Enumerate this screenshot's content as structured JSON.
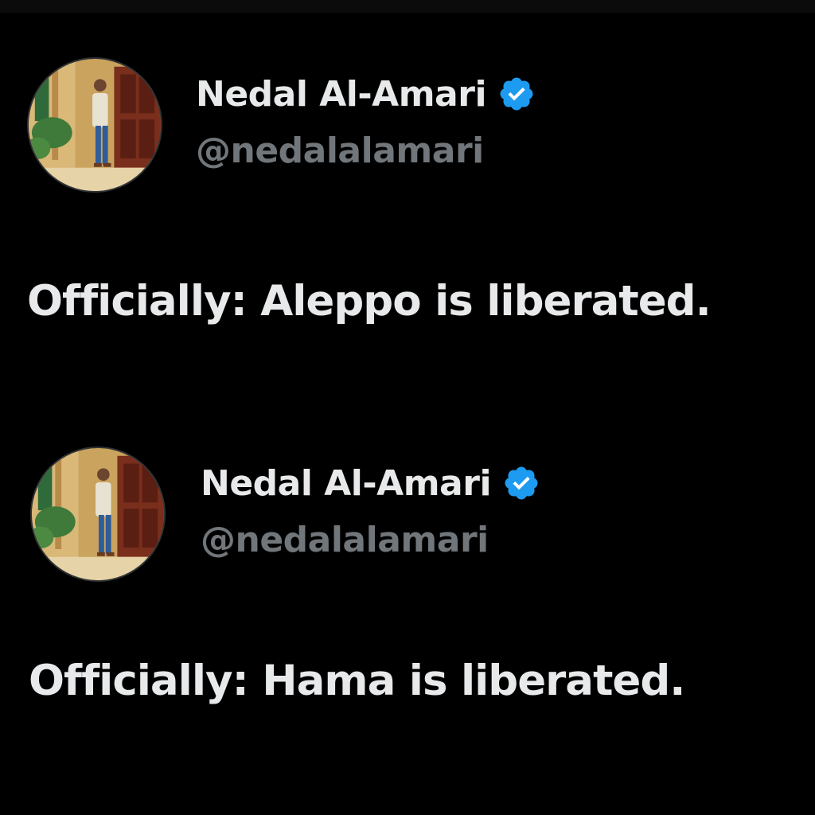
{
  "colors": {
    "background": "#000000",
    "primary_text": "#e7e9ea",
    "secondary_text": "#71767b",
    "verified_badge": "#1d9bf0"
  },
  "posts": [
    {
      "author": {
        "display_name": "Nedal Al-Amari",
        "handle": "@nedalalamari",
        "verified_icon": "verified-badge-icon",
        "avatar": "profile-photo"
      },
      "text": "Officially: Aleppo is liberated."
    },
    {
      "author": {
        "display_name": "Nedal Al-Amari",
        "handle": "@nedalalamari",
        "verified_icon": "verified-badge-icon",
        "avatar": "profile-photo"
      },
      "text": "Officially: Hama is liberated."
    }
  ]
}
